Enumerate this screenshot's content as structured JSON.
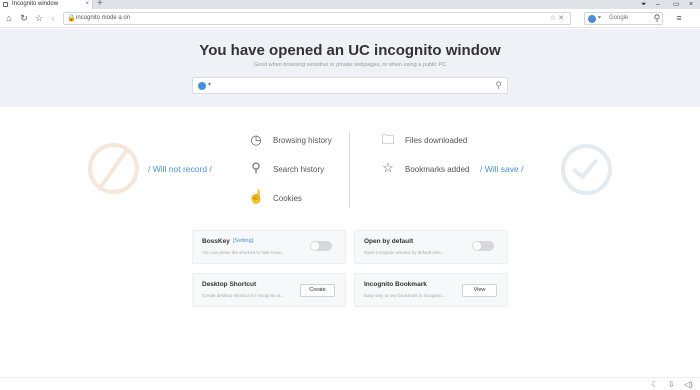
{
  "tab": {
    "title": "Incognito window",
    "close": "×",
    "new_tab": "+"
  },
  "window_controls": {
    "minimize": "–",
    "maximize": "▭",
    "close": "×",
    "extra": "⏷"
  },
  "toolbar": {
    "address": "incognito mode a on",
    "lock": "🔒",
    "addr_icons": "☆  ✕",
    "search_engine": "Google",
    "search_icon": "⚲",
    "menu_icon": "≡"
  },
  "hero": {
    "title": "You have opened an UC incognito window",
    "subtitle": "Good when browsing sensitive or private webpages, or when using a public PC",
    "search_arrow": "▾",
    "search_icon": "⚲"
  },
  "privacy": {
    "not_record_label": "/ Will not record /",
    "save_label": "/ Will save /",
    "not_recorded": [
      {
        "label": "Browsing history",
        "icon": "clock-icon"
      },
      {
        "label": "Search history",
        "icon": "search-icon"
      },
      {
        "label": "Cookies",
        "icon": "cookie-icon"
      }
    ],
    "saved": [
      {
        "label": "Files downloaded",
        "icon": "folder-icon"
      },
      {
        "label": "Bookmarks added",
        "icon": "star-icon"
      }
    ]
  },
  "cards": {
    "bosskey": {
      "title": "BossKey",
      "settings": "[Setting]",
      "desc": "You can press the shortcut to hide brow...",
      "enabled": false
    },
    "open_default": {
      "title": "Open by default",
      "desc": "Open incognito window by default whe...",
      "enabled": false
    },
    "desktop_shortcut": {
      "title": "Desktop Shortcut",
      "desc": "Create desktop shortcut for incognito w...",
      "button": "Create"
    },
    "incognito_bookmark": {
      "title": "Incognito Bookmark",
      "desc": "Easy way to use bookmark in incognito...",
      "button": "View"
    }
  },
  "colors": {
    "accent": "#4a90d9",
    "hero_bg": "#eef1f6"
  }
}
